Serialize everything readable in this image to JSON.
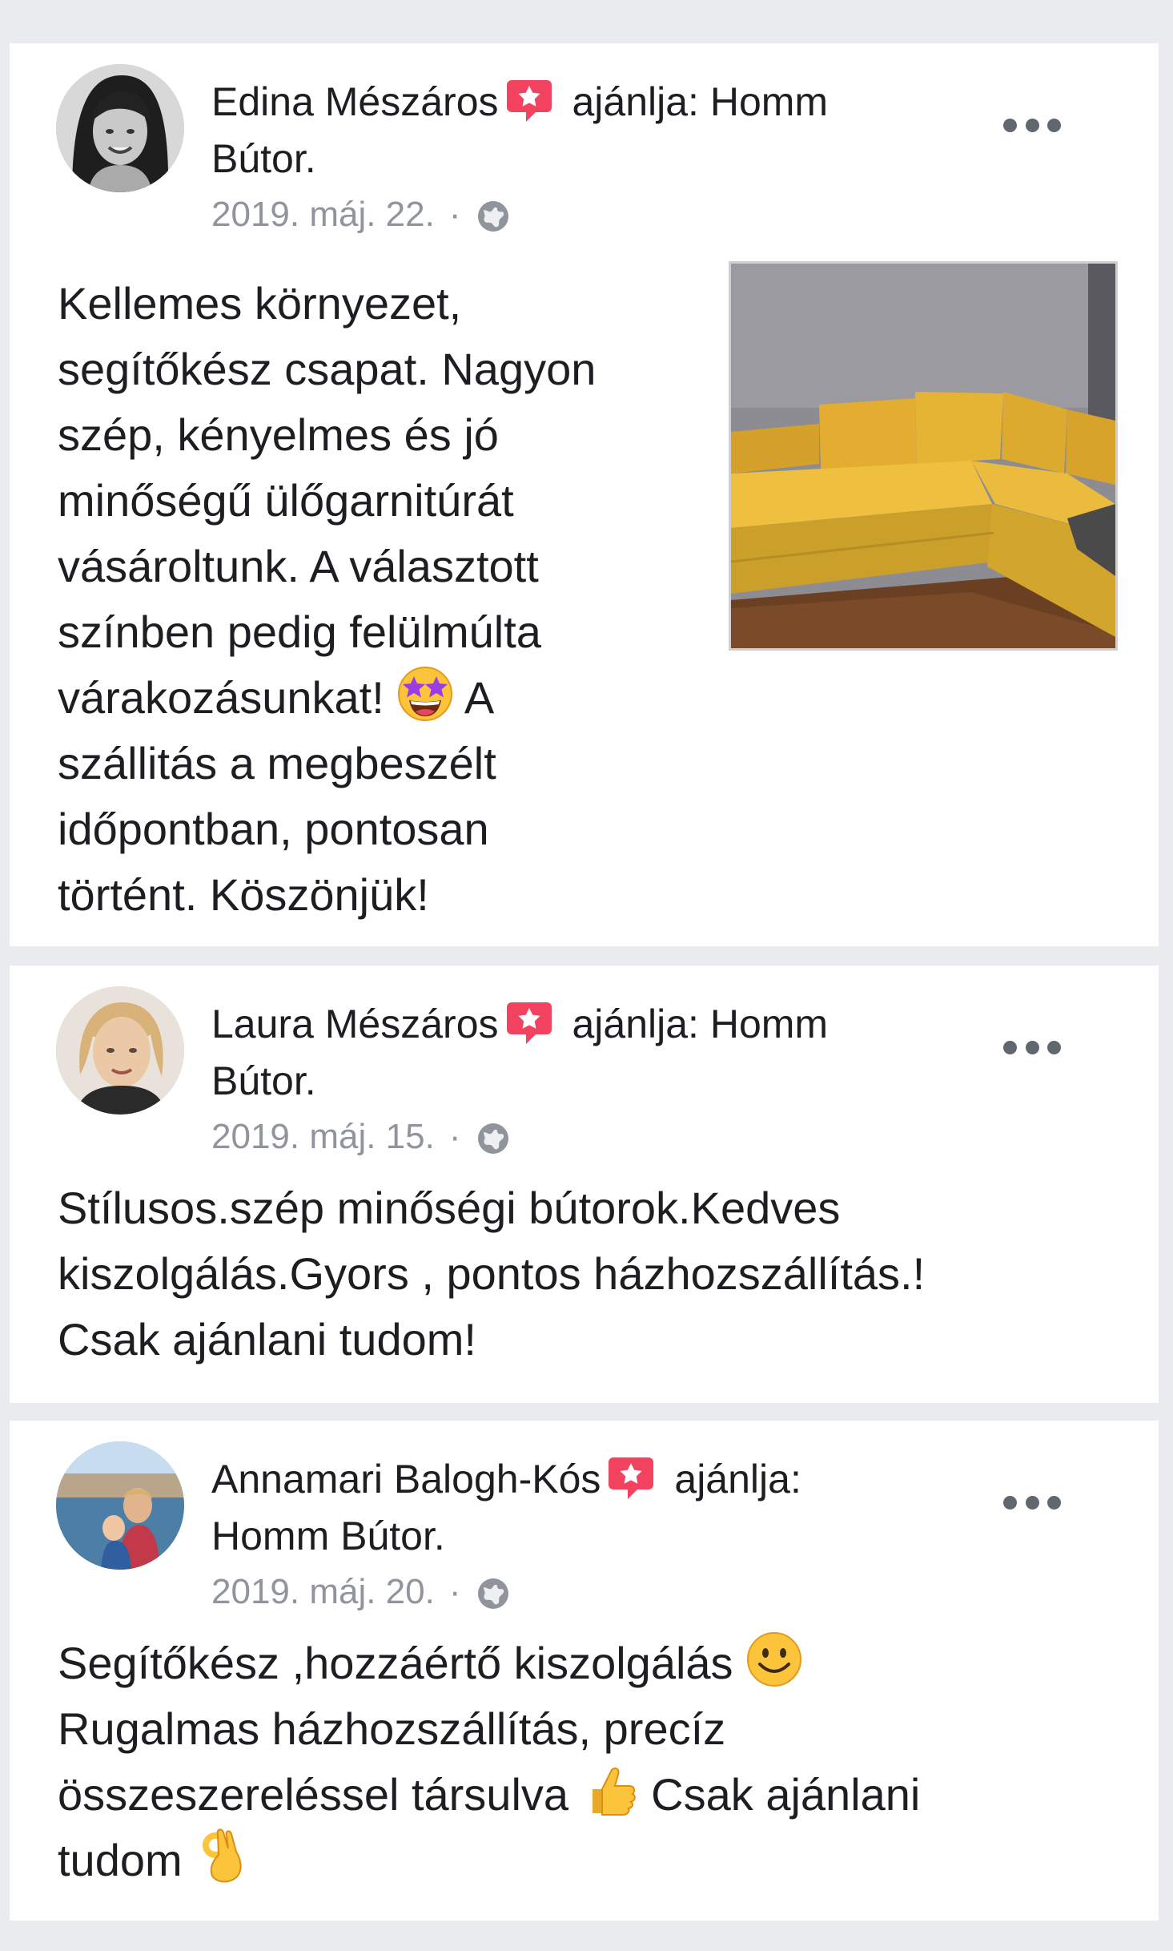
{
  "posts": [
    {
      "author": "Edina Mészáros",
      "action": "ajánlja: Homm",
      "page": "Bútor.",
      "date": "2019. máj. 22.",
      "separator": "·",
      "text_part1": "Kellemes környezet,\nsegítőkész csapat. Nagyon\nszép, kényelmes és jó\nminőségű ülőgarnitúrát\nvásároltunk. A választott\nszínben pedig felülmúlta\nvárakozásunkat! ",
      "text_part2": " A\nszállitás a megbeszélt\nidőpontban, pontosan\ntörtént. Köszönjük!",
      "emoji": "star-struck-emoji",
      "photo": "yellow-corner-sofa-photo"
    },
    {
      "author": "Laura Mészáros",
      "action": "ajánlja: Homm",
      "page": "Bútor.",
      "date": "2019. máj. 15.",
      "separator": "·",
      "text": "Stílusos.szép minőségi bútorok.Kedves\nkiszolgálás.Gyors , pontos házhozszállítás.!\nCsak ajánlani tudom!"
    },
    {
      "author": "Annamari Balogh-Kós",
      "action": "ajánlja:",
      "page": "Homm Bútor.",
      "date": "2019. máj. 20.",
      "separator": "·",
      "text_part1": "Segítőkész ,hozzáértő kiszolgálás ",
      "text_part2": "\nRugalmas házhozszállítás, precíz\nösszeszereléssel társulva ",
      "text_part3": " Csak ajánlani\ntudom ",
      "emojis": [
        "smile-emoji",
        "thumbs-up-emoji",
        "ok-hand-emoji"
      ]
    }
  ],
  "colors": {
    "background": "#e9ebee",
    "card": "#ffffff",
    "text": "#1c1e21",
    "meta": "#90949c",
    "badge": "#f3425f",
    "more_dots": "#606770"
  },
  "icons": {
    "recommend_badge": "recommend-star-icon",
    "privacy": "globe-icon",
    "more": "more-options-icon"
  }
}
